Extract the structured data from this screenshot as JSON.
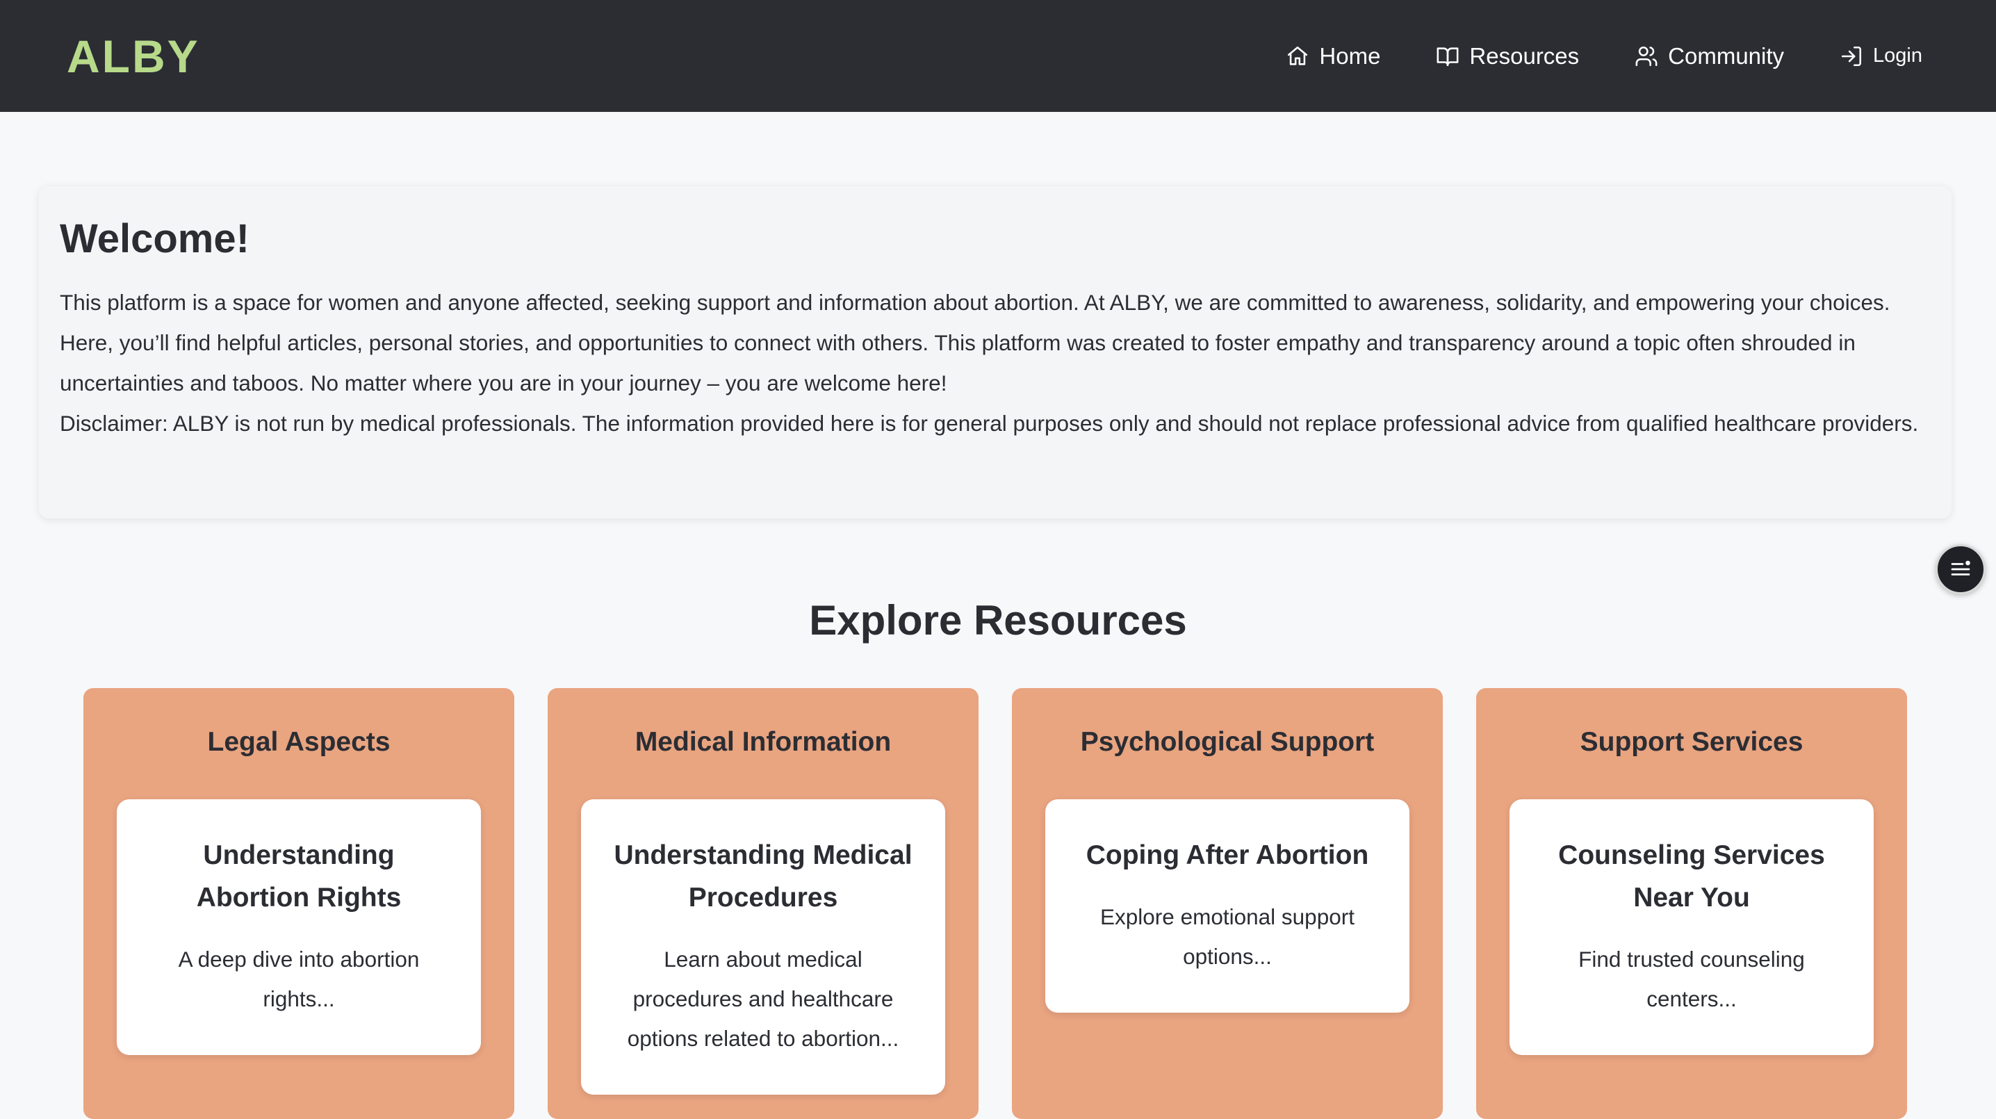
{
  "header": {
    "logo": "ALBY",
    "nav": {
      "home": "Home",
      "resources": "Resources",
      "community": "Community",
      "login": "Login"
    }
  },
  "welcome": {
    "title": "Welcome!",
    "intro": "This platform is a space for women and anyone affected, seeking support and information about abortion. At ALBY, we are committed to awareness, solidarity, and empowering your choices. Here, you’ll find helpful articles, personal stories, and opportunities to connect with others. This platform was created to foster empathy and transparency around a topic often shrouded in uncertainties and taboos. No matter where you are in your journey – you are welcome here!",
    "disclaimer": "Disclaimer: ALBY is not run by medical professionals. The information provided here is for general purposes only and should not replace professional advice from qualified healthcare providers."
  },
  "explore": {
    "title": "Explore Resources",
    "categories": [
      {
        "name": "Legal Aspects",
        "article_title": "Understanding Abortion Rights",
        "article_excerpt": "A deep dive into abortion rights..."
      },
      {
        "name": "Medical Information",
        "article_title": "Understanding Medical Procedures",
        "article_excerpt": "Learn about medical procedures and healthcare options related to abortion..."
      },
      {
        "name": "Psychological Support",
        "article_title": "Coping After Abortion",
        "article_excerpt": "Explore emotional support options..."
      },
      {
        "name": "Support Services",
        "article_title": "Counseling Services Near You",
        "article_excerpt": "Find trusted counseling centers..."
      }
    ]
  },
  "icons": {
    "home": "home-icon",
    "resources": "book-open-icon",
    "community": "users-icon",
    "login": "log-in-icon",
    "fab": "menu-icon"
  },
  "colors": {
    "navbar": "#2b2d33",
    "logo": "#b7d98a",
    "background": "#f7f8fa",
    "category_card": "#e9a480",
    "article_card": "#ffffff",
    "text": "#2b2d33"
  }
}
